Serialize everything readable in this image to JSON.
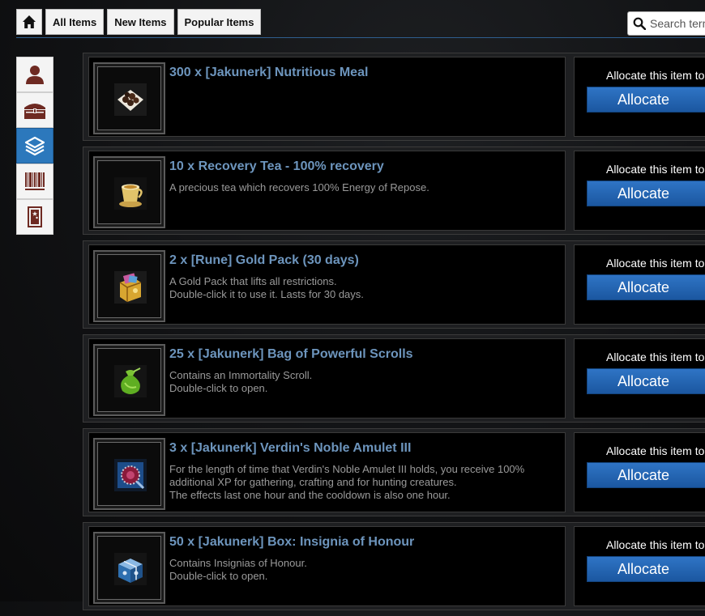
{
  "topnav": {
    "home_icon": "home-icon",
    "tabs": [
      {
        "label": "All Items"
      },
      {
        "label": "New Items"
      },
      {
        "label": "Popular Items"
      }
    ]
  },
  "search": {
    "placeholder": "Search terms"
  },
  "sidebar": {
    "items": [
      {
        "icon": "person-icon"
      },
      {
        "icon": "chest-icon"
      },
      {
        "icon": "layers-icon",
        "active": true
      },
      {
        "icon": "barcode-icon"
      },
      {
        "icon": "door-icon"
      }
    ]
  },
  "colors": {
    "accent": "#2c78bc",
    "title": "#6d95bd",
    "button": "#2264b0"
  },
  "items": [
    {
      "title": "300 x [Jakunerk] Nutritious Meal",
      "desc": [],
      "icon": "food-bowl-icon",
      "alloc_label": "Allocate this item to",
      "alloc_button": "Allocate"
    },
    {
      "title": "10 x Recovery Tea - 100% recovery",
      "desc": [
        "A precious tea which recovers 100% Energy of Repose."
      ],
      "icon": "tea-cup-icon",
      "alloc_label": "Allocate this item to",
      "alloc_button": "Allocate"
    },
    {
      "title": "2 x [Rune] Gold Pack (30 days)",
      "desc": [
        "A Gold Pack that lifts all restrictions.",
        "Double-click it to use it. Lasts for 30 days."
      ],
      "icon": "gold-pack-icon",
      "alloc_label": "Allocate this item to",
      "alloc_button": "Allocate"
    },
    {
      "title": "25 x [Jakunerk] Bag of Powerful Scrolls",
      "desc": [
        "Contains an Immortality Scroll.",
        "Double-click to open."
      ],
      "icon": "green-bag-icon",
      "alloc_label": "Allocate this item to",
      "alloc_button": "Allocate"
    },
    {
      "title": "3 x [Jakunerk] Verdin's Noble Amulet III",
      "desc": [
        "For the length of time that Verdin's Noble Amulet III holds, you receive 100%",
        "additional XP for gathering, crafting and for hunting creatures.",
        "The effects last one hour and the cooldown is also one hour."
      ],
      "icon": "amulet-icon",
      "alloc_label": "Allocate this item to",
      "alloc_button": "Allocate"
    },
    {
      "title": "50 x [Jakunerk] Box: Insignia of Honour",
      "desc": [
        "Contains Insignias of Honour.",
        "Double-click to open."
      ],
      "icon": "blue-box-icon",
      "alloc_label": "Allocate this item to",
      "alloc_button": "Allocate"
    }
  ]
}
